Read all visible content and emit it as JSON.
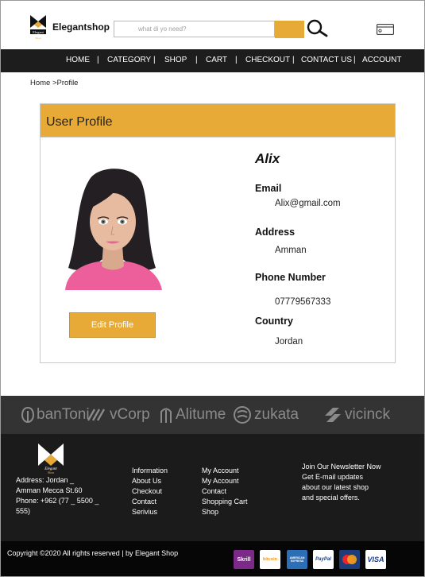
{
  "header": {
    "logo_text": "Elegantshop",
    "search_placeholder": "what di yo need?"
  },
  "nav": {
    "items": [
      "HOME",
      "CATEGORY",
      "SHOP",
      "CART",
      "CHECKOUT",
      "CONTACT US",
      "ACCOUNT"
    ],
    "separator": "|"
  },
  "breadcrumb": {
    "home": "Home",
    "sep": " >",
    "current": "Profile"
  },
  "profile": {
    "title": "User Profile",
    "name": "Alix",
    "email_label": "Email",
    "email": "Alix@gmail.com",
    "address_label": "Address",
    "address": "Amman",
    "phone_label": "Phone Number",
    "phone": "07779567333",
    "country_label": "Country",
    "country": "Jordan",
    "edit_button": "Edit Profile"
  },
  "brands": [
    "banToni",
    "vCorp",
    "Alitume",
    "zukata",
    "vicinck"
  ],
  "footer": {
    "address_lines": [
      "Address: Jordan _",
      "Amman Mecca St.60",
      "Phone: +962 (77 _ 5500 _",
      "555)"
    ],
    "links_col1": [
      "Information",
      "About Us",
      "Checkout",
      "Contact",
      "Serivius"
    ],
    "links_col2": [
      "My Account",
      "My Account",
      "Contact",
      "Shopping Cart",
      "Shop"
    ],
    "newsletter_title": "Join Our Newsletter Now",
    "newsletter_lines": [
      "Get E-mail updates",
      "about our latest shop",
      "and special offers."
    ],
    "copyright": "Copyright ©2020 All rights reserved | by Elegant Shop"
  },
  "payments": [
    "Skrill",
    "bitcoin",
    "AMERICAN EXPRESS",
    "PayPal",
    "MasterCard",
    "VISA"
  ],
  "colors": {
    "accent": "#e8aa37",
    "nav_bg": "#1d1d1d",
    "footer_bg": "#1b1b1b"
  }
}
